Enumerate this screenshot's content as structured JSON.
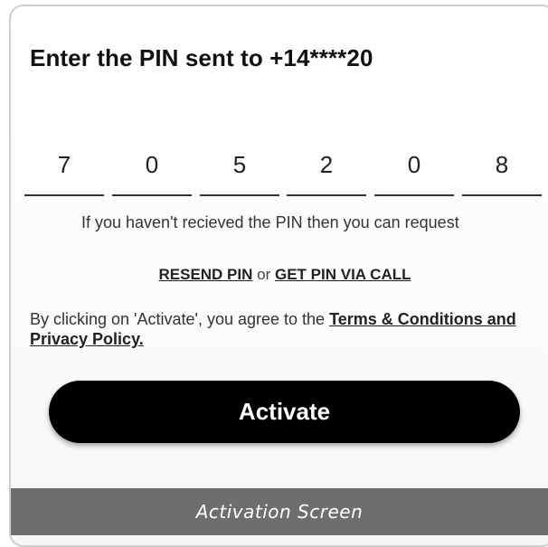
{
  "screen": {
    "heading": "Enter the PIN sent to +14****20"
  },
  "pin": {
    "digits": [
      "7",
      "0",
      "5",
      "2",
      "0",
      "8"
    ]
  },
  "info": {
    "text": "If you haven't recieved the PIN then you can request"
  },
  "resend": {
    "resend_label": "RESEND PIN",
    "or_label": "or",
    "call_label": "GET PIN VIA CALL"
  },
  "terms": {
    "prefix": "By clicking on 'Activate', you agree to the ",
    "link_label": "Terms & Conditions and Privacy Policy."
  },
  "actions": {
    "activate_label": "Activate"
  },
  "caption": {
    "text": "Activation Screen"
  },
  "colors": {
    "button_bg": "#000000",
    "button_text": "#ffffff",
    "caption_bg": "#6e6e6e"
  }
}
